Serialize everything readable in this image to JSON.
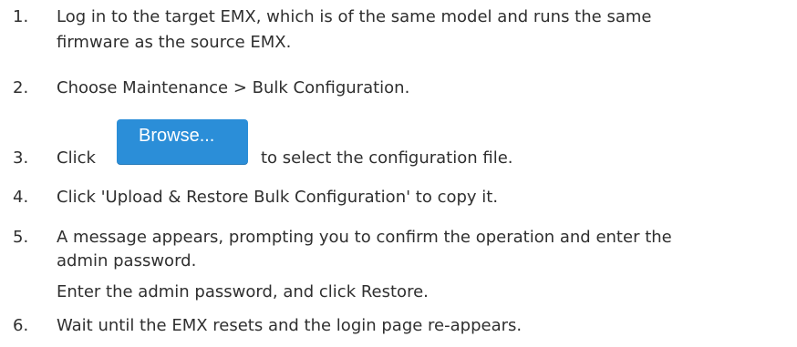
{
  "steps": [
    {
      "number": "1.",
      "line1": "Log in to the target EMX, which is of the same model and runs the same",
      "line2": "firmware as the source EMX."
    },
    {
      "number": "2.",
      "line1": "Choose Maintenance > Bulk Configuration."
    },
    {
      "number": "3.",
      "prefix": "Click",
      "button_label": "Browse...",
      "suffix": "to select the configuration file."
    },
    {
      "number": "4.",
      "line1": "Click 'Upload & Restore Bulk Configuration' to copy it."
    },
    {
      "number": "5.",
      "line1": "A message appears, prompting you to confirm the operation and enter the",
      "line2": "admin password.",
      "extra": "Enter the admin password, and click Restore."
    },
    {
      "number": "6.",
      "line1": "Wait until the EMX resets and the login page re-appears."
    }
  ],
  "colors": {
    "text": "#2f2f2f",
    "button_bg": "#2b8ed8",
    "button_text": "#ffffff"
  }
}
